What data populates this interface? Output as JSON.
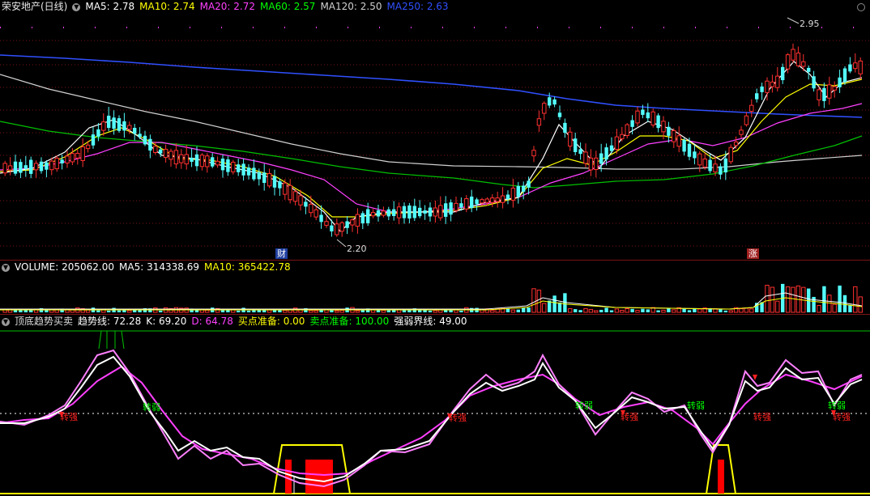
{
  "title": "荣安地产(日线)",
  "price_panel": {
    "legend": [
      {
        "label": "MA5:",
        "value": "2.78",
        "color": "#ffffff"
      },
      {
        "label": "MA10:",
        "value": "2.74",
        "color": "#ffff00"
      },
      {
        "label": "MA20:",
        "value": "2.72",
        "color": "#ff40ff"
      },
      {
        "label": "MA60:",
        "value": "2.57",
        "color": "#00ff00"
      },
      {
        "label": "MA120:",
        "value": "2.50",
        "color": "#d0d0d0"
      },
      {
        "label": "MA250:",
        "value": "2.63",
        "color": "#3050ff"
      }
    ],
    "high_label": "2.95",
    "low_label": "2.20",
    "marker_cai": "财",
    "marker_zhang": "涨",
    "colors": {
      "up": "#ff3030",
      "down": "#54fcfc",
      "bg": "#000000",
      "grid": "#7a1515"
    }
  },
  "volume_panel": {
    "legend": [
      {
        "label": "VOLUME:",
        "value": "205062.00",
        "color": "#ffffff"
      },
      {
        "label": "MA5:",
        "value": "314338.69",
        "color": "#ffffff"
      },
      {
        "label": "MA10:",
        "value": "365422.78",
        "color": "#ffff00"
      }
    ]
  },
  "indicator_panel": {
    "name": "顶底趋势买卖",
    "legend": [
      {
        "label": "趋势线:",
        "value": "72.28",
        "color": "#ffffff"
      },
      {
        "label": "K:",
        "value": "69.20",
        "color": "#ffffff"
      },
      {
        "label": "D:",
        "value": "64.78",
        "color": "#ff40ff"
      },
      {
        "label": "买点准备:",
        "value": "0.00",
        "color": "#ffff00"
      },
      {
        "label": "卖点准备:",
        "value": "100.00",
        "color": "#00ff00"
      },
      {
        "label": "强弱界线:",
        "value": "49.00",
        "color": "#ffffff"
      }
    ],
    "signals": {
      "strong": "转强",
      "weak": "转弱"
    }
  }
}
